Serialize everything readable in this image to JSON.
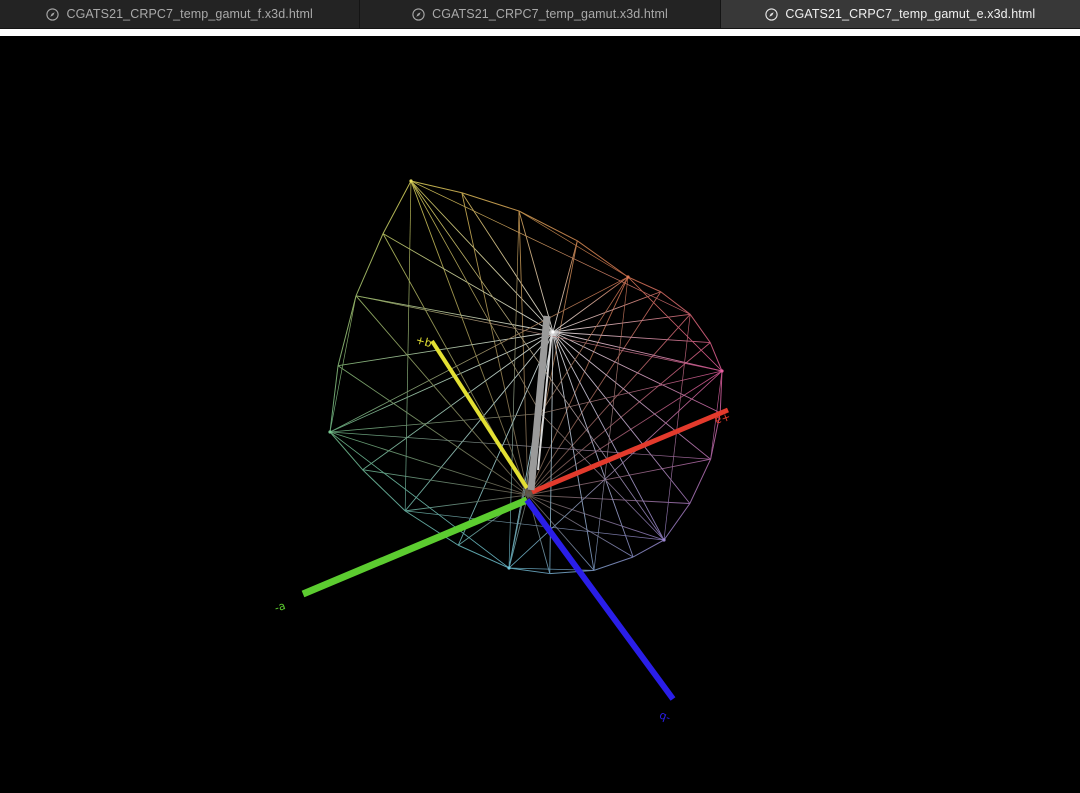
{
  "tabs": [
    {
      "title": "CGATS21_CRPC7_temp_gamut_f.x3d.html",
      "active": false,
      "icon": "compass-icon"
    },
    {
      "title": "CGATS21_CRPC7_temp_gamut.x3d.html",
      "active": false,
      "icon": "compass-icon"
    },
    {
      "title": "CGATS21_CRPC7_temp_gamut_e.x3d.html",
      "active": true,
      "icon": "compass-icon"
    }
  ],
  "scene": {
    "background": "#000000",
    "axes": [
      {
        "name": "+a",
        "label": "+a",
        "color": "#e33a2c"
      },
      {
        "name": "-a",
        "label": "-a",
        "color": "#5ccc30"
      },
      {
        "name": "+b",
        "label": "+b",
        "color": "#e3e033"
      },
      {
        "name": "-b",
        "label": "-b",
        "color": "#2a1ee8"
      },
      {
        "name": "L",
        "label": "",
        "color": "#9a9a9a"
      }
    ],
    "gamut_vertices": [
      {
        "name": "yellow",
        "color": "#e8de60"
      },
      {
        "name": "red",
        "color": "#e07a55"
      },
      {
        "name": "magenta",
        "color": "#e85ea0"
      },
      {
        "name": "blue",
        "color": "#9a86d0"
      },
      {
        "name": "cyan",
        "color": "#6fc4d8"
      },
      {
        "name": "green",
        "color": "#78c690"
      },
      {
        "name": "white",
        "color": "#ffffff"
      },
      {
        "name": "black",
        "color": "#5a5a5a"
      }
    ]
  }
}
